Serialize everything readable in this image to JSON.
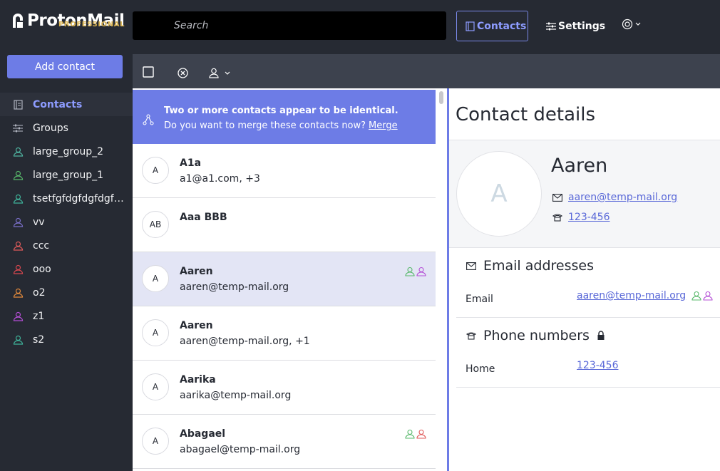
{
  "header": {
    "logo_text": "ProtonMail",
    "logo_sub": "PROFESSIONAL",
    "search_placeholder": "Search",
    "nav_contacts": "Contacts",
    "nav_settings": "Settings"
  },
  "sidebar": {
    "add_contact": "Add contact",
    "items": [
      {
        "label": "Contacts",
        "icon": "contacts-icon",
        "color": "#aeb2bd"
      },
      {
        "label": "Groups",
        "icon": "groups-sliders-icon",
        "color": "#aeb2bd"
      },
      {
        "label": "large_group_2",
        "icon": "user-icon",
        "color": "#4fb3a0"
      },
      {
        "label": "large_group_1",
        "icon": "user-icon",
        "color": "#57b86a"
      },
      {
        "label": "tsetfgfdgfdgfdgfdgfdgfd",
        "icon": "user-icon",
        "color": "#3fb39a"
      },
      {
        "label": "vv",
        "icon": "user-icon",
        "color": "#7a6fc9"
      },
      {
        "label": "ccc",
        "icon": "user-icon",
        "color": "#e05a5a"
      },
      {
        "label": "ooo",
        "icon": "user-icon",
        "color": "#d9474f"
      },
      {
        "label": "o2",
        "icon": "user-icon",
        "color": "#e38a3c"
      },
      {
        "label": "z1",
        "icon": "user-icon",
        "color": "#b44ed6"
      },
      {
        "label": "s2",
        "icon": "user-icon",
        "color": "#3fb39a"
      }
    ]
  },
  "merge_banner": {
    "line1": "Two or more contacts appear to be identical.",
    "line2": "Do you want to merge these contacts now?",
    "link": "Merge"
  },
  "contacts": [
    {
      "initials": "A",
      "name": "A1a",
      "sub": "a1@a1.com, +3",
      "badges": []
    },
    {
      "initials": "AB",
      "name": "Aaa BBB",
      "sub": "",
      "badges": []
    },
    {
      "initials": "A",
      "name": "Aaren",
      "sub": "aaren@temp-mail.org",
      "badges": [
        "#57b86a",
        "#b44ed6"
      ],
      "selected": true
    },
    {
      "initials": "A",
      "name": "Aaren",
      "sub": "aaren@temp-mail.org, +1",
      "badges": []
    },
    {
      "initials": "A",
      "name": "Aarika",
      "sub": "aarika@temp-mail.org",
      "badges": []
    },
    {
      "initials": "A",
      "name": "Abagael",
      "sub": "abagael@temp-mail.org",
      "badges": [
        "#57b86a",
        "#e05a5a"
      ]
    }
  ],
  "details": {
    "title": "Contact details",
    "avatar_initial": "A",
    "name": "Aaren",
    "email": "aaren@temp-mail.org",
    "phone": "123-456",
    "email_section": "Email addresses",
    "email_label": "Email",
    "email_value": "aaren@temp-mail.org",
    "phone_section": "Phone numbers",
    "phone_label": "Home",
    "phone_value": "123-456"
  }
}
